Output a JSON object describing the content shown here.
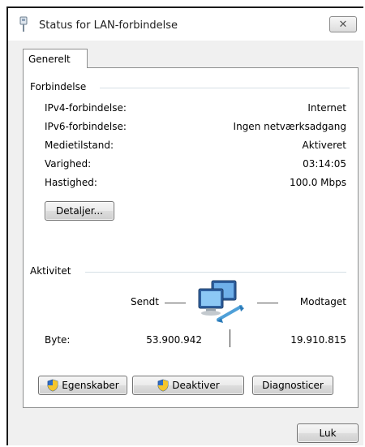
{
  "window": {
    "title": "Status for LAN-forbindelse",
    "close_glyph": "✕"
  },
  "tabs": [
    {
      "label": "Generelt"
    }
  ],
  "connection": {
    "section_title": "Forbindelse",
    "rows": [
      {
        "label": "IPv4-forbindelse:",
        "value": "Internet"
      },
      {
        "label": "IPv6-forbindelse:",
        "value": "Ingen netværksadgang"
      },
      {
        "label": "Medietilstand:",
        "value": "Aktiveret"
      },
      {
        "label": "Varighed:",
        "value": "03:14:05"
      },
      {
        "label": "Hastighed:",
        "value": "100.0 Mbps"
      }
    ],
    "details_button": "Detaljer..."
  },
  "activity": {
    "section_title": "Aktivitet",
    "sent_label": "Sendt",
    "received_label": "Modtaget",
    "bytes_label": "Byte:",
    "bytes_sent": "53.900.942",
    "bytes_received": "19.910.815"
  },
  "buttons": {
    "properties": "Egenskaber",
    "disable": "Deaktiver",
    "diagnose": "Diagnosticer",
    "close": "Luk"
  },
  "icons": {
    "title": "network-adapter-icon",
    "network": "network-computers-icon",
    "shield": "uac-shield-icon"
  },
  "colors": {
    "panel_border": "#8e8f8f",
    "group_line": "#d5dfe5",
    "window_bg": "#f0f0f0"
  }
}
